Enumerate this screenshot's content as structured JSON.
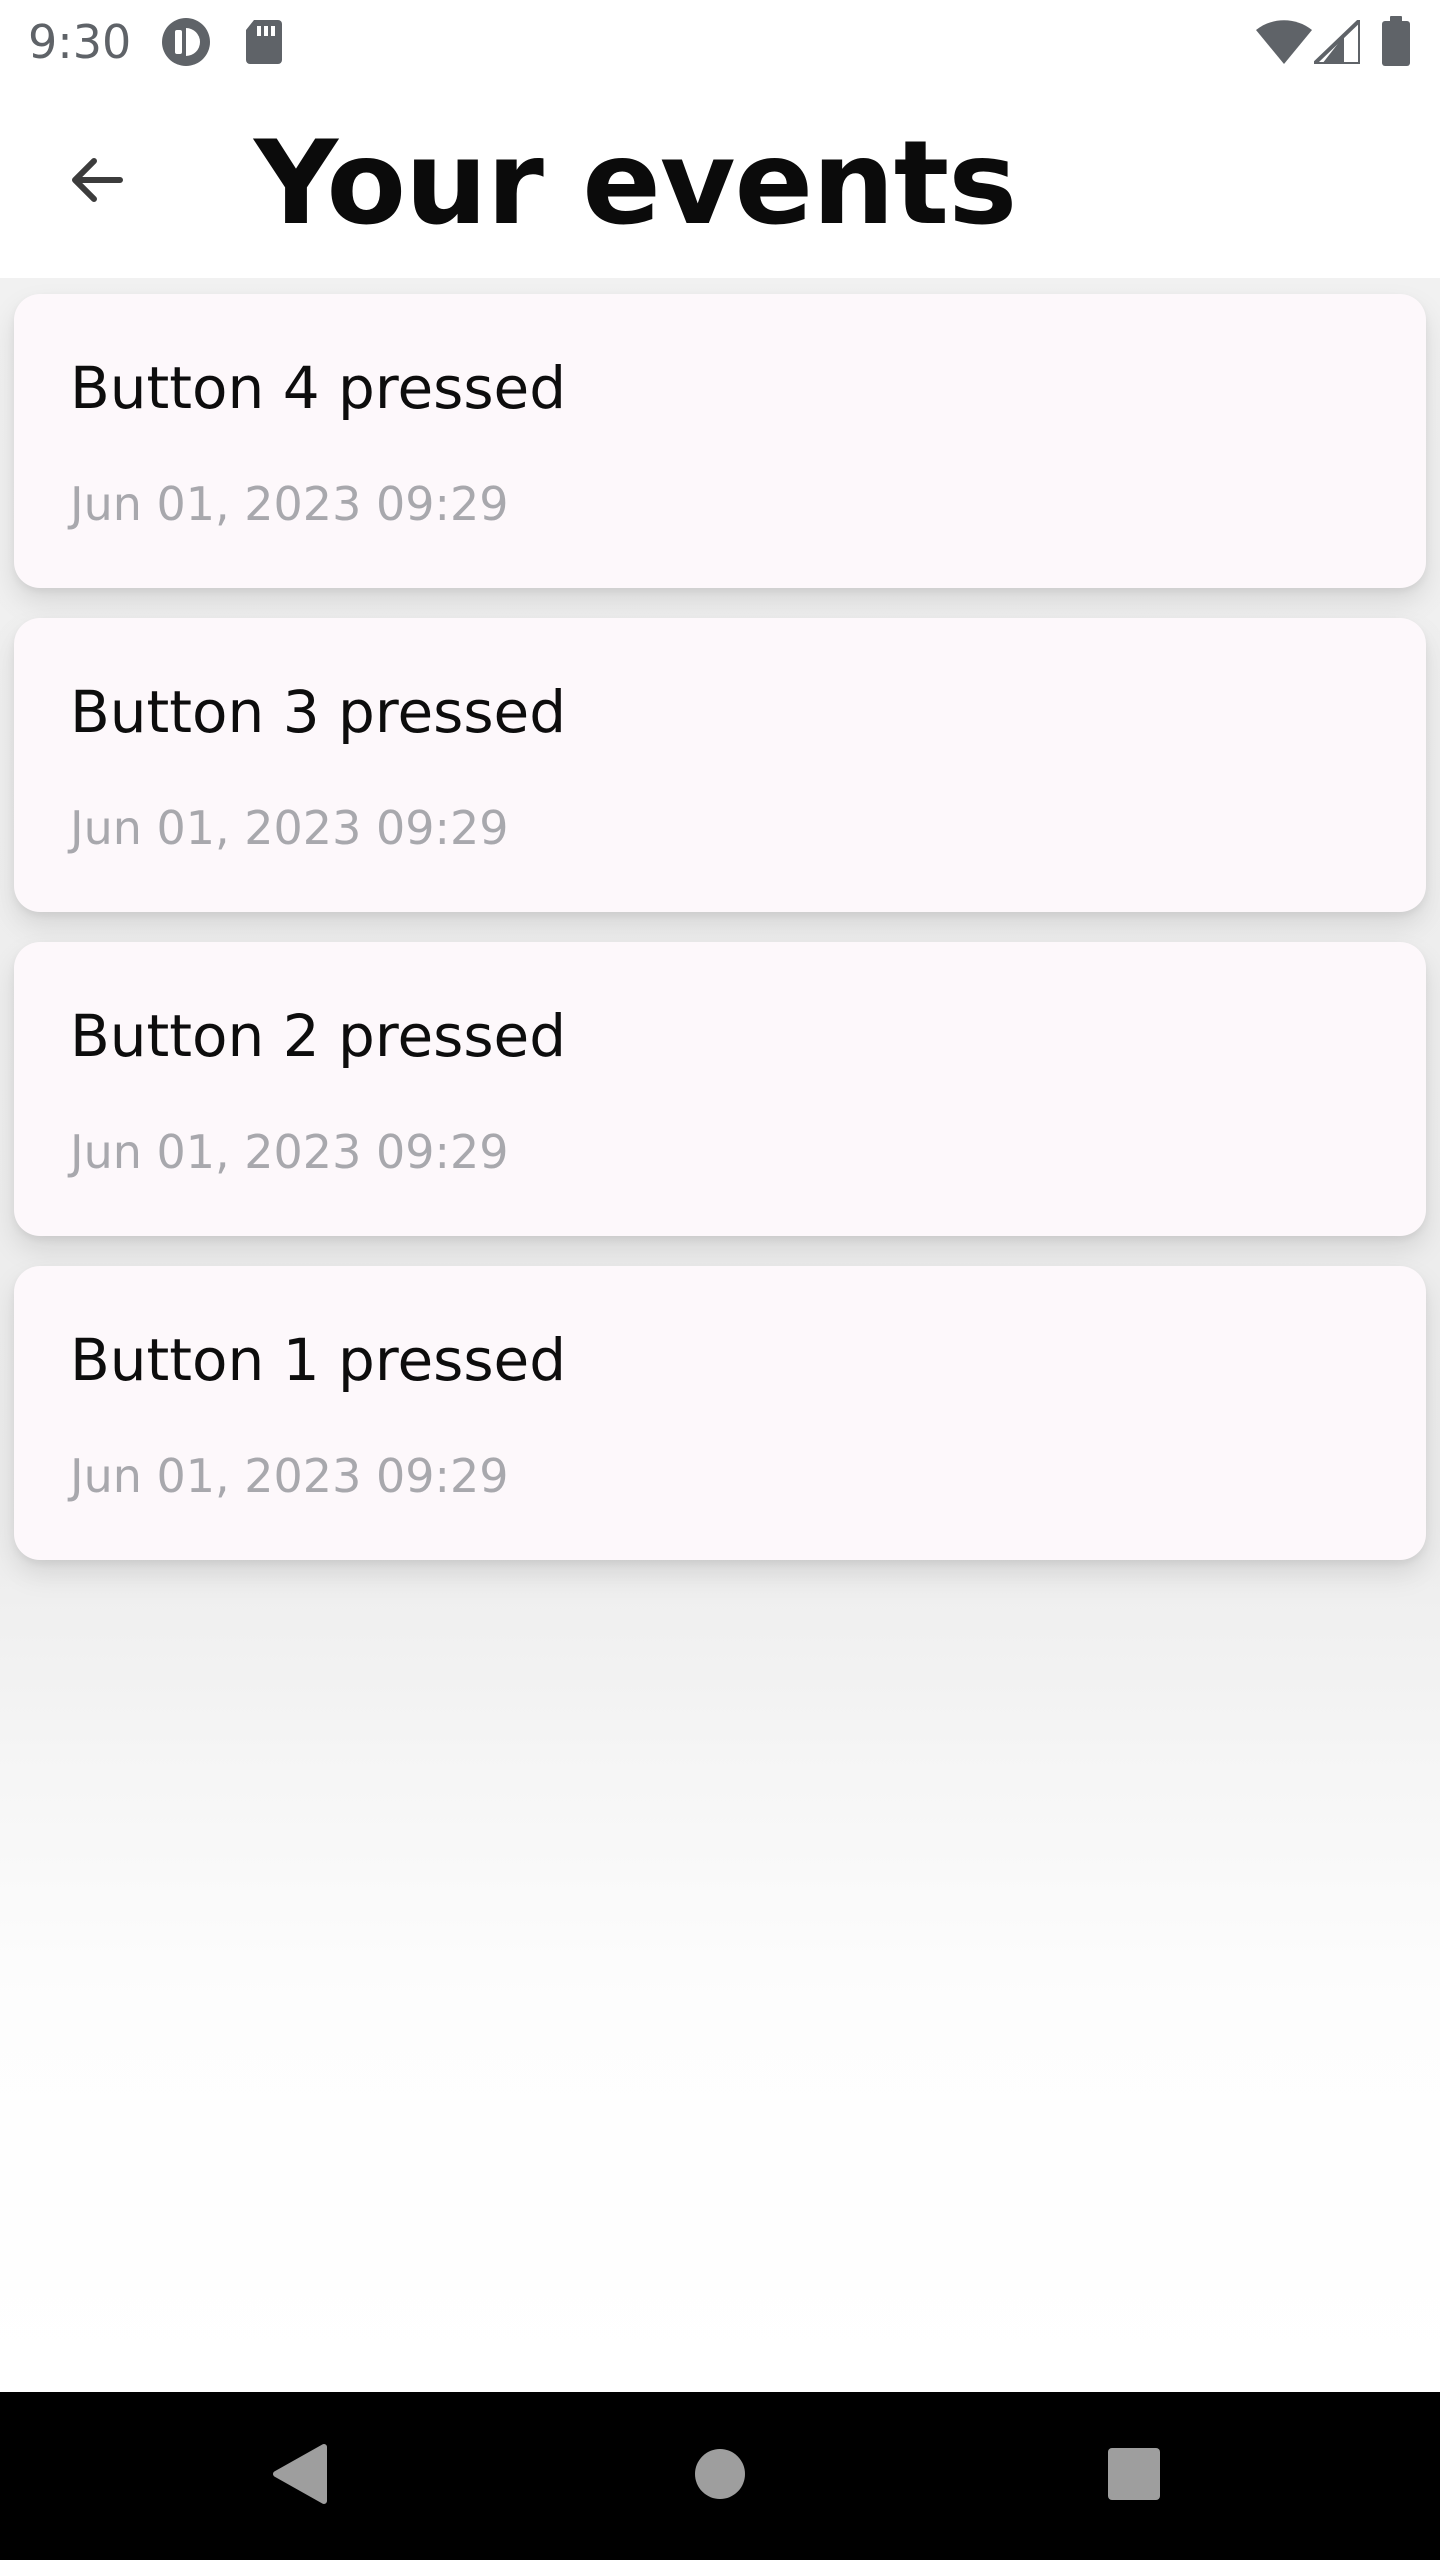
{
  "status_bar": {
    "time": "9:30",
    "left_icons": [
      "app-notification-icon",
      "sd-card-icon"
    ],
    "right_icons": [
      "wifi-icon",
      "cell-signal-icon",
      "battery-icon"
    ]
  },
  "app_bar": {
    "back_icon": "arrow-back-icon",
    "title": "Your events"
  },
  "events": [
    {
      "title": "Button 4 pressed",
      "date": "Jun 01, 2023 09:29"
    },
    {
      "title": "Button 3 pressed",
      "date": "Jun 01, 2023 09:29"
    },
    {
      "title": "Button 2 pressed",
      "date": "Jun 01, 2023 09:29"
    },
    {
      "title": "Button 1 pressed",
      "date": "Jun 01, 2023 09:29"
    }
  ],
  "nav_bar": {
    "buttons": [
      "back-triangle-icon",
      "home-circle-icon",
      "recents-square-icon"
    ]
  },
  "colors": {
    "card_background": "#fdf8fb",
    "list_background": "#f1f1f1",
    "title_text": "#0b0b0b",
    "date_text": "#a8a8ad",
    "nav_bar": "#000000",
    "nav_icons": "#9e9e9e"
  }
}
